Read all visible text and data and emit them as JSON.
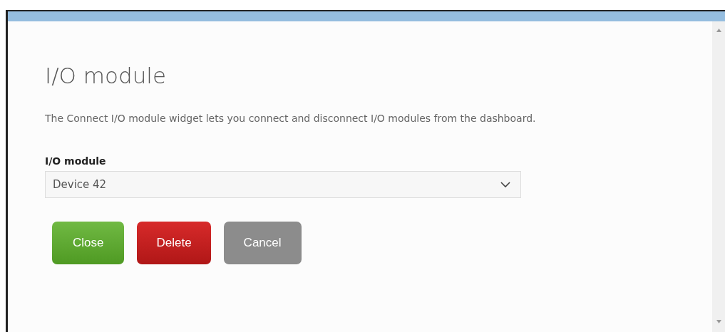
{
  "dialog": {
    "title": "I/O module",
    "description": "The Connect I/O module widget lets you connect and disconnect I/O modules from the dashboard.",
    "field": {
      "label": "I/O module",
      "value": "Device 42"
    },
    "buttons": [
      {
        "label": "Close",
        "kind": "success"
      },
      {
        "label": "Delete",
        "kind": "danger"
      },
      {
        "label": "Cancel",
        "kind": "neutral"
      }
    ]
  }
}
